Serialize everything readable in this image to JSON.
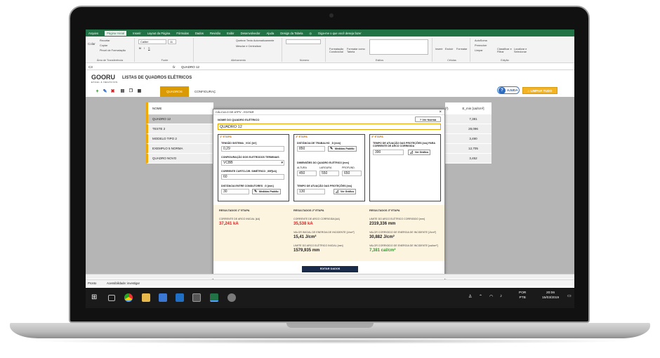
{
  "ribbon": {
    "tabs": [
      "Arquivo",
      "Página Inicial",
      "Inserir",
      "Layout da Página",
      "Fórmulas",
      "Dados",
      "Revisão",
      "Exibir",
      "Desenvolvedor",
      "Ajuda",
      "Design da Tabela"
    ],
    "active_tab": "Página Inicial",
    "tell_me": "Diga-me o que você deseja fazer",
    "clipboard": {
      "paste": "Colar",
      "cut": "Recortar",
      "copy": "Copiar",
      "painter": "Pincel de Formatação",
      "label": "Área de Transferência"
    },
    "font": {
      "name": "Calibri",
      "size": "11",
      "label": "Fonte"
    },
    "alignment": {
      "wrap": "Quebrar Texto Automaticamente",
      "merge": "Mesclar e Centralizar",
      "label": "Alinhamento"
    },
    "number": {
      "label": "Número"
    },
    "styles": {
      "conditional": "Formatação Condicional",
      "table": "Formatar como Tabela",
      "label": "Estilos"
    },
    "cells": {
      "insert": "Inserir",
      "delete": "Excluir",
      "format": "Formatar",
      "label": "Células"
    },
    "editing": {
      "autosum": "AutoSoma",
      "fill": "Preencher",
      "clear": "Limpar",
      "sort": "Classificar e Filtrar",
      "find": "Localizar e Selecionar",
      "label": "Edição"
    }
  },
  "formula_bar": {
    "fx": "fx",
    "value": "QUADRO 12"
  },
  "sheet": {
    "logo": "GOORU",
    "logo_sub": "EXCEL & NEGÓCIOS",
    "title": "LISTAS DE QUADROS ELÉTRICOS",
    "nav_tabs": [
      "QUADROS",
      "CONFIGURAÇ"
    ],
    "help_label": "AJUDA",
    "clear_label": "LIMPAR TUDO",
    "list_header": "NOME",
    "list_items": [
      "QUADRO 12",
      "TESTE 2",
      "MODELO TIPO 2",
      "EXEMPLO 5 NORMA",
      "QUADRO NOVO"
    ],
    "right_header_a": "(²)",
    "right_header_b": "E_min [cal/cm²]",
    "right_values": [
      "7,381",
      "28,096",
      "3,490",
      "12,705",
      "3,452"
    ]
  },
  "status": {
    "ready": "Pronto",
    "accessibility": "Acessibilidade: investigar"
  },
  "taskbar": {
    "lang": "POR",
    "layout": "PTB",
    "time": "20:06",
    "date": "15/03/2019"
  },
  "dialog": {
    "title": "CÁLCULO DE ATPV - EDITAR",
    "name_label": "NOME DO QUADRO ELÉTRICO",
    "name_value": "QUADRO 12",
    "ver_norma": "Ver Norma",
    "etapa1": {
      "tag": "1ª ETAPA",
      "tensao_label": "TENSÃO SISTEMA _VOC [kV]",
      "tensao_value": "0,29",
      "config_label": "CONFIGURAÇÃO DOS ELETRODOS TERMINAIS",
      "config_value": "VCBB",
      "corrente_label": "CORRENTE CURTO-CIR. SIMÉTRICO _IBF[kA]",
      "corrente_value": "60",
      "dist_label": "DISTÂNCIA ENTRE CONDUTORES _G [mm]",
      "dist_value": "30",
      "medidas": "Medidas Padrão"
    },
    "etapa2": {
      "tag": "2ª ETAPA",
      "trabalho_label": "DISTÂNCIA DE TRABALHO _D [mm]",
      "trabalho_value": "850",
      "medidas": "Medidas Padrão",
      "dim_label": "DIMENSÕES DO QUADRO ELÉTRICO [mm]",
      "altura_label": "ALTURA",
      "largura_label": "LARGURA",
      "prof_label": "PROFUND.",
      "altura": "450",
      "largura": "550",
      "prof": "650",
      "tempo_label": "TEMPO DE ATUAÇÃO DAS PROTEÇÕES [ms]",
      "tempo_value": "130",
      "ver_graficos": "Ver Gráfico"
    },
    "etapa3": {
      "tag": "3ª ETAPA",
      "tempo_label": "TEMPO DE ATUAÇÃO DAS PROTEÇÕES [ms] PARA CORRENTE DE ARCO CORRIGIDA",
      "tempo_value": "390",
      "ver_graficos": "Ver Gráfico"
    },
    "res1": {
      "title": "RESULTADOS 1ª ETAPA",
      "label": "CORRENTE DE ARCO INICIAL [kA]",
      "value": "37,241 kA"
    },
    "res2": {
      "title": "RESULTADOS 2ª ETAPA",
      "l1": "CORRENTE DE ARCO CORRIGIDA [kA]",
      "v1": "35,538 kA",
      "l2": "VALOR INICIAL DE ENERGIA DE INCIDENTE [J/cm²]",
      "v2": "15,41 J/cm²",
      "l3": "LIMITE DO ARCO ELÉTRICO INICIAL [mm]",
      "v3": "1579,935 mm"
    },
    "res3": {
      "title": "RESULTADOS 3ª ETAPA",
      "l1": "LIMITE DO ARCO ELÉTRICO CORRIGIDO [mm]",
      "v1": "2319,336 mm",
      "l2": "VALOR CORRIGIDO DE ENERGIA DE INCIDENTE [J/cm²]",
      "v2": "30,882 J/cm²",
      "l3": "VALOR CORRIGIDO DE ENERGIA DE INCIDENTE [cal/cm²]",
      "v3": "7,381 cal/cm²"
    },
    "editar": "EDITAR DADOS"
  },
  "colors": {
    "excel_green": "#217346",
    "accent_orange": "#f0a900",
    "red_value": "#d32020",
    "green_value": "#2e9b2e"
  }
}
